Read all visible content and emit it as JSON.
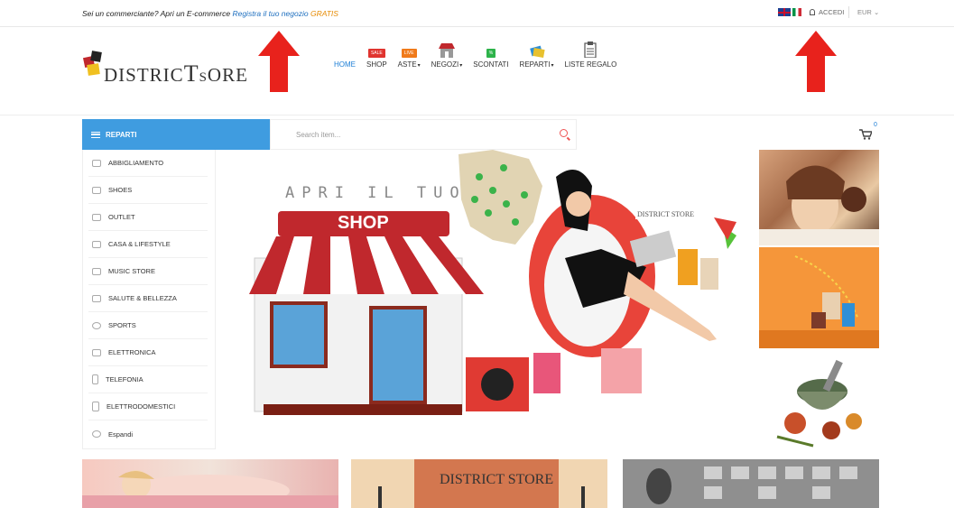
{
  "topbar": {
    "promo_text": "Sei un commerciante? Apri un E-commerce",
    "promo_link": "Registra il tuo negozio",
    "promo_free": "GRATIS",
    "login_label": "ACCEDI",
    "currency": "EUR",
    "currency_caret": "⌄"
  },
  "logo": {
    "text_a": "DISTRIC",
    "text_t": "T",
    "text_b": "S",
    "text_c": "ORE"
  },
  "nav": [
    {
      "label": "HOME",
      "icon": "none",
      "active": true
    },
    {
      "label": "SHOP",
      "icon": "sale-badge",
      "badge": "SALE"
    },
    {
      "label": "ASTE",
      "icon": "live-badge",
      "badge": "LIVE",
      "caret": "▾"
    },
    {
      "label": "NEGOZI",
      "icon": "store-icon",
      "caret": "▾"
    },
    {
      "label": "SCONTATI",
      "icon": "discount-badge",
      "badge": "%"
    },
    {
      "label": "REPARTI",
      "icon": "cards-icon",
      "caret": "▾"
    },
    {
      "label": "LISTE REGALO",
      "icon": "clipboard-icon"
    }
  ],
  "reparti_label": "REPARTI",
  "search": {
    "placeholder": "Search item..."
  },
  "cart": {
    "count": "0"
  },
  "categories": [
    {
      "label": "ABBIGLIAMENTO",
      "icon": "shirt-icon"
    },
    {
      "label": "SHOES",
      "icon": "shoe-icon"
    },
    {
      "label": "OUTLET",
      "icon": "percent-icon"
    },
    {
      "label": "CASA & LIFESTYLE",
      "icon": "sofa-icon"
    },
    {
      "label": "MUSIC STORE",
      "icon": "music-icon"
    },
    {
      "label": "SALUTE & BELLEZZA",
      "icon": "heart-icon"
    },
    {
      "label": "SPORTS",
      "icon": "ball-icon"
    },
    {
      "label": "ELETTRONICA",
      "icon": "monitor-icon"
    },
    {
      "label": "TELEFONIA",
      "icon": "phone-icon"
    },
    {
      "label": "ELETTRODOMESTICI",
      "icon": "appliance-icon"
    },
    {
      "label": "Espandi",
      "icon": "plus-icon"
    }
  ],
  "banner": {
    "headline": "APRI IL TUO",
    "awning_label": "SHOP",
    "mini_logo": "DISTRICT STORE"
  },
  "bottom_banner_logo": "DISTRICT STORE",
  "colors": {
    "accent_blue": "#3f9ce0",
    "link_blue": "#1e6fbf",
    "gratis_orange": "#e68a00",
    "awning_red": "#c0282d",
    "arrow_red": "#e8221c"
  }
}
